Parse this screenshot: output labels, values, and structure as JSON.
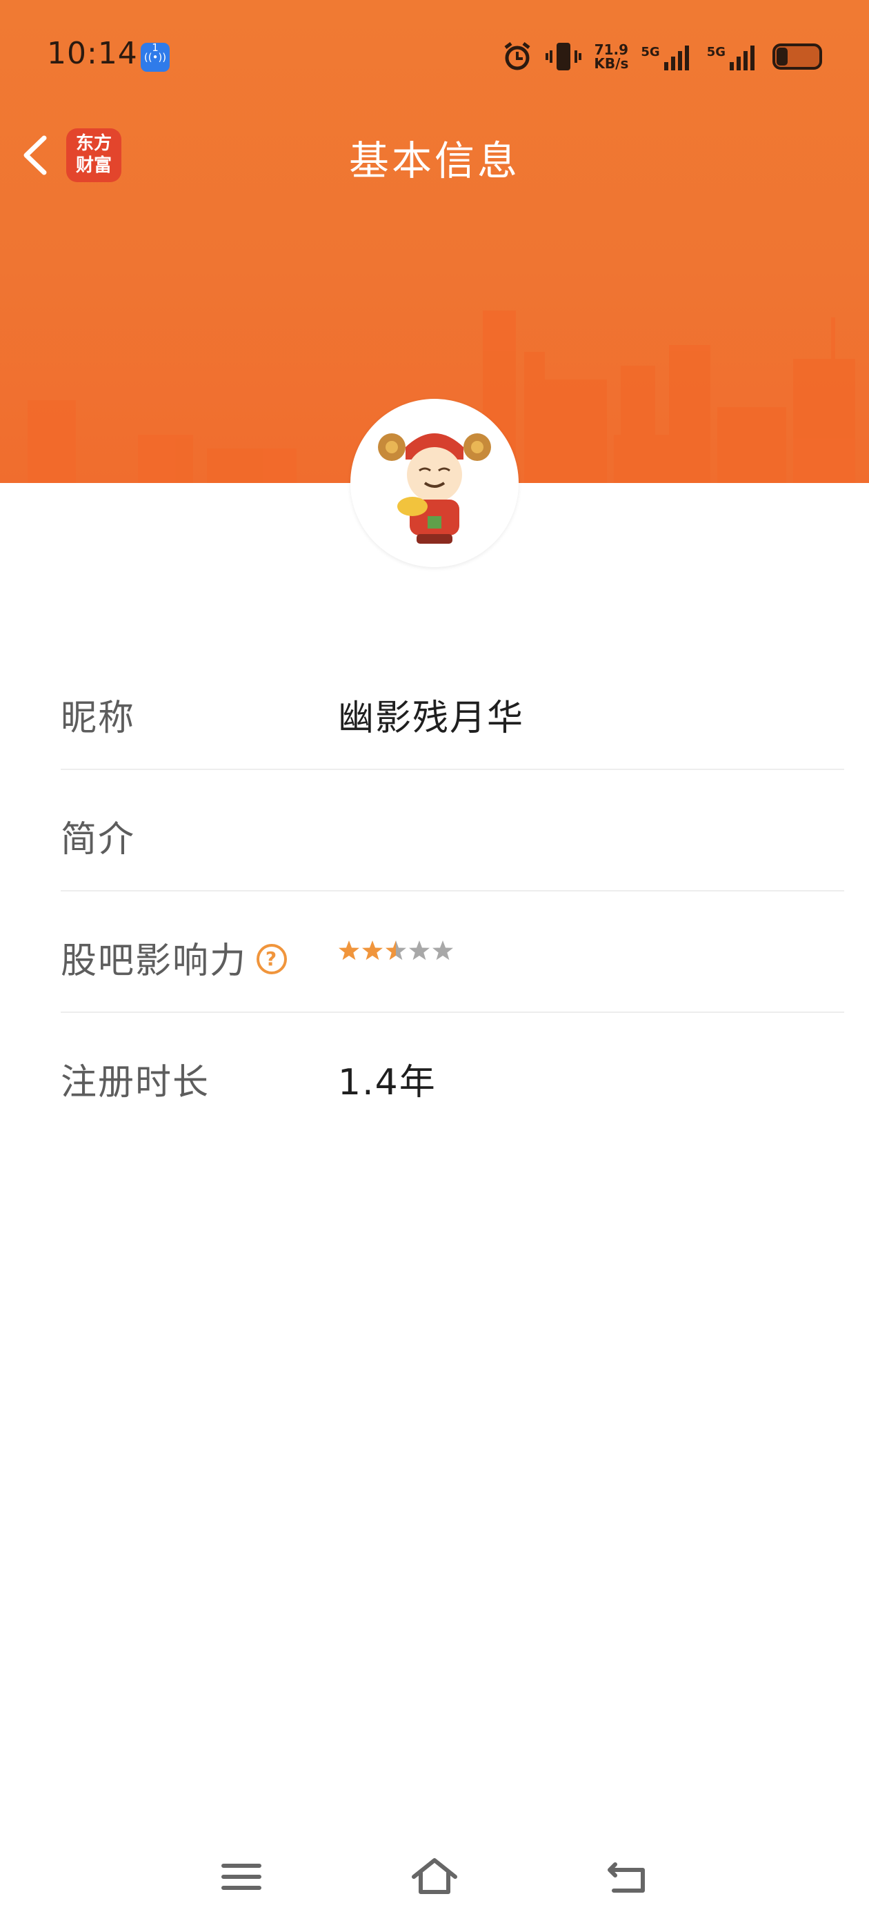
{
  "status_bar": {
    "time": "10:14",
    "hotspot_badge": "1",
    "net_speed_value": "71.9",
    "net_speed_unit": "KB/s",
    "signal_1": "5G",
    "signal_2": "5G"
  },
  "nav": {
    "title": "基本信息",
    "app_logo_line1": "东方",
    "app_logo_line2": "财富"
  },
  "profile": {
    "rows": [
      {
        "label": "昵称",
        "value": "幽影残月华"
      },
      {
        "label": "简介",
        "value": ""
      },
      {
        "label": "股吧影响力",
        "help": "?",
        "rating": 2.5,
        "rating_max": 5
      },
      {
        "label": "注册时长",
        "value": "1.4年"
      }
    ]
  },
  "colors": {
    "banner": "#ef7532",
    "star_active": "#f0953c",
    "star_inactive": "#a8a8a8"
  },
  "icons": [
    "back-icon",
    "help-icon",
    "star-icon",
    "menu-icon",
    "home-icon",
    "return-icon",
    "alarm-icon",
    "vibrate-icon",
    "battery-icon"
  ]
}
